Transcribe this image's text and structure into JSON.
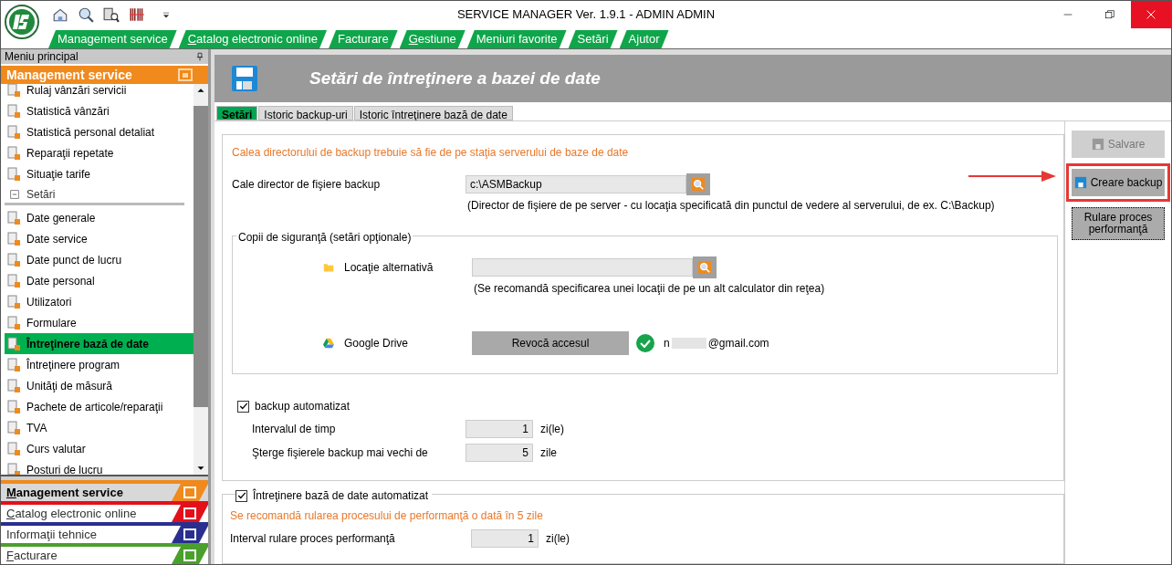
{
  "window": {
    "title": "SERVICE MANAGER Ver. 1.9.1 - ADMIN ADMIN"
  },
  "menu_tabs": [
    {
      "label": "Management service",
      "underlined_first": false
    },
    {
      "label": "Catalog electronic online",
      "underlined_first": true
    },
    {
      "label": "Facturare",
      "underlined_first": false
    },
    {
      "label": "Gestiune",
      "underlined_first": true
    },
    {
      "label": "Meniuri favorite",
      "underlined_first": false
    },
    {
      "label": "Setări",
      "underlined_first": false
    },
    {
      "label": "Ajutor",
      "underlined_first": false
    }
  ],
  "sidebar": {
    "title": "Meniu principal",
    "active_section": "Management service",
    "items": [
      {
        "kind": "item",
        "label": "Rulaj vânzări servicii",
        "selected": false
      },
      {
        "kind": "item",
        "label": "Statistică vânzări",
        "selected": false
      },
      {
        "kind": "item",
        "label": "Statistică personal detaliat",
        "selected": false
      },
      {
        "kind": "item",
        "label": "Reparaţii repetate",
        "selected": false
      },
      {
        "kind": "item",
        "label": "Situaţie tarife",
        "selected": false
      },
      {
        "kind": "group",
        "label": "Setări",
        "expanded": true
      },
      {
        "kind": "item",
        "label": "Date generale",
        "selected": false
      },
      {
        "kind": "item",
        "label": "Date service",
        "selected": false
      },
      {
        "kind": "item",
        "label": "Date punct de lucru",
        "selected": false
      },
      {
        "kind": "item",
        "label": "Date personal",
        "selected": false
      },
      {
        "kind": "item",
        "label": "Utilizatori",
        "selected": false
      },
      {
        "kind": "item",
        "label": "Formulare",
        "selected": false
      },
      {
        "kind": "item",
        "label": "Întreţinere bază de date",
        "selected": true
      },
      {
        "kind": "item",
        "label": "Întreţinere program",
        "selected": false
      },
      {
        "kind": "item",
        "label": "Unităţi de măsură",
        "selected": false
      },
      {
        "kind": "item",
        "label": "Pachete de articole/reparaţii",
        "selected": false
      },
      {
        "kind": "item",
        "label": "TVA",
        "selected": false
      },
      {
        "kind": "item",
        "label": "Curs valutar",
        "selected": false
      },
      {
        "kind": "item",
        "label": "Posturi de lucru",
        "selected": false
      }
    ],
    "sections": [
      {
        "label": "Management service",
        "color": "#f08a1c",
        "selected": true,
        "underlined_first": true
      },
      {
        "label": "Catalog electronic online",
        "color": "#e3101c",
        "selected": false,
        "underlined_first": true
      },
      {
        "label": "Informaţii tehnice",
        "color": "#2a2f8f",
        "selected": false,
        "underlined_first": false
      },
      {
        "label": "Facturare",
        "color": "#4aa02c",
        "selected": false,
        "underlined_first": true
      }
    ]
  },
  "page": {
    "title": "Setări de întreţinere a bazei de date",
    "tabs": [
      {
        "label": "Setări",
        "selected": true
      },
      {
        "label": "Istoric backup-uri",
        "selected": false
      },
      {
        "label": "Istoric întreţinere bază de date",
        "selected": false
      }
    ],
    "backup": {
      "note": "Calea directorului de backup trebuie să fie de pe staţia serverului de baze de date",
      "path_label": "Cale director de fişiere backup",
      "path_value": "c:\\ASMBackup",
      "path_hint": "(Director de fişiere de pe server - cu locaţia specificată din punctul de vedere al serverului, de ex. C:\\Backup)"
    },
    "copies": {
      "legend": "Copii de siguranţă (setări opţionale)",
      "alt_label": "Locaţie alternativă",
      "alt_hint": "(Se recomandă specificarea unei locaţii de pe un alt calculator din reţea)",
      "drive_label": "Google Drive",
      "revoke_button": "Revocă accesul",
      "connected": true,
      "email_start": "n",
      "email_end": "@gmail.com"
    },
    "auto_backup": {
      "label": "backup automatizat",
      "checked": true,
      "interval_label": "Intervalul de timp",
      "interval_value": "1",
      "interval_unit": "zi(le)",
      "delete_label": "Şterge fişierele backup mai vechi de",
      "delete_value": "5",
      "delete_unit": "zile"
    },
    "maintenance": {
      "label": "Întreţinere bază de date automatizat",
      "checked": true,
      "note": "Se recomandă rularea procesului de performanţă o dată în 5 zile",
      "interval_label": "Interval rulare proces performanţă",
      "interval_value": "1",
      "interval_unit": "zi(le)"
    },
    "actions": [
      {
        "label": "Salvare",
        "disabled": true,
        "highlighted": false,
        "focused": false,
        "icon": true
      },
      {
        "label": "Creare backup",
        "disabled": false,
        "highlighted": true,
        "focused": false,
        "icon": true
      },
      {
        "label": "Rulare proces performanţă",
        "disabled": false,
        "highlighted": false,
        "focused": true,
        "icon": false
      }
    ]
  }
}
